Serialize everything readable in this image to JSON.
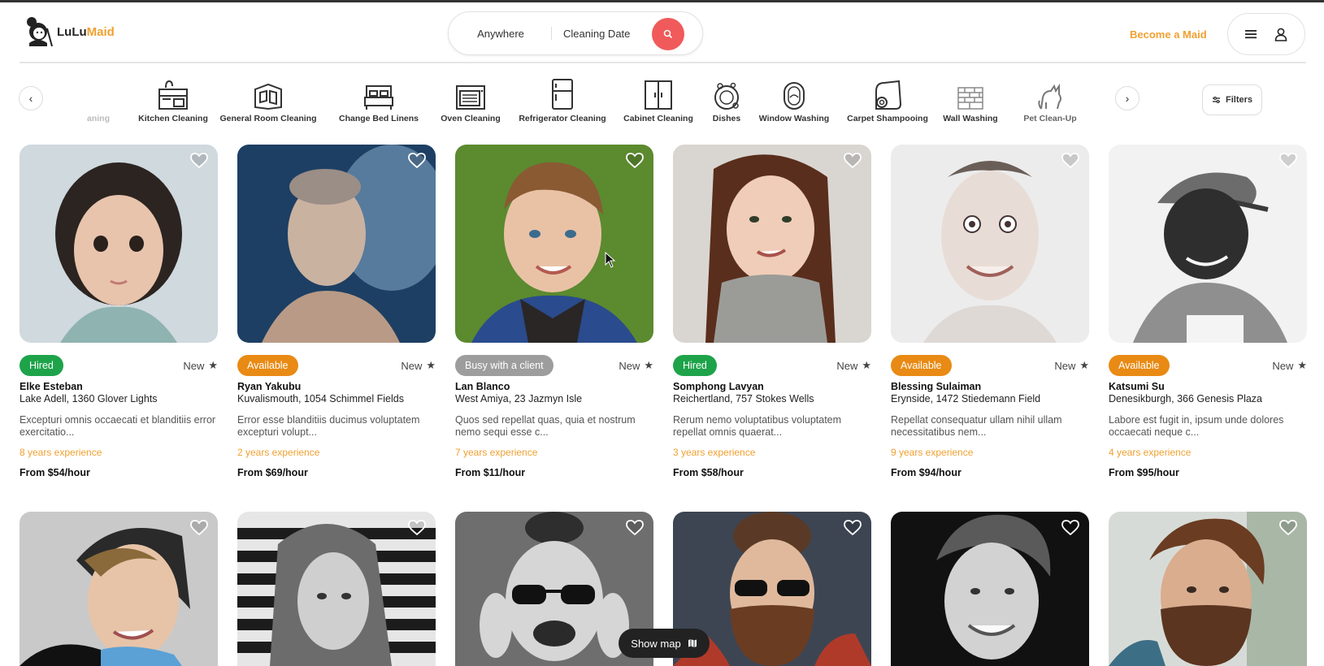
{
  "header": {
    "logo_part1": "LuLu",
    "logo_part2": "Maid",
    "search_location": "Anywhere",
    "search_date": "Cleaning Date",
    "become_maid": "Become a Maid"
  },
  "categories": {
    "items": [
      {
        "label": "Deep Cleaning",
        "visible_label": "aning",
        "icon": "broom-icon"
      },
      {
        "label": "Kitchen Cleaning",
        "icon": "kitchen-icon"
      },
      {
        "label": "General Room Cleaning",
        "icon": "room-icon"
      },
      {
        "label": "Change Bed Linens",
        "icon": "bed-icon"
      },
      {
        "label": "Oven Cleaning",
        "icon": "oven-icon"
      },
      {
        "label": "Refrigerator Cleaning",
        "icon": "refrigerator-icon"
      },
      {
        "label": "Cabinet Cleaning",
        "icon": "cabinet-icon"
      },
      {
        "label": "Dishes",
        "icon": "dishes-icon"
      },
      {
        "label": "Window Washing",
        "icon": "window-icon"
      },
      {
        "label": "Carpet Shampooing",
        "icon": "carpet-icon"
      },
      {
        "label": "Wall Washing",
        "icon": "wall-icon"
      },
      {
        "label": "Pet Clean-Up",
        "icon": "pet-icon"
      }
    ],
    "filters_label": "Filters"
  },
  "listings": [
    {
      "status": "Hired",
      "new": "New",
      "name": "Elke Esteban",
      "address": "Lake Adell, 1360 Glover Lights",
      "description": "Excepturi omnis occaecati et blanditiis error exercitatio...",
      "experience": "8 years experience",
      "price": "From $54/hour"
    },
    {
      "status": "Available",
      "new": "New",
      "name": "Ryan Yakubu",
      "address": "Kuvalismouth, 1054 Schimmel Fields",
      "description": "Error esse blanditiis ducimus voluptatem excepturi volupt...",
      "experience": "2 years experience",
      "price": "From $69/hour"
    },
    {
      "status": "Busy with a client",
      "new": "New",
      "name": "Lan Blanco",
      "address": "West Amiya, 23 Jazmyn Isle",
      "description": "Quos sed repellat quas, quia et nostrum nemo sequi esse c...",
      "experience": "7 years experience",
      "price": "From $11/hour"
    },
    {
      "status": "Hired",
      "new": "New",
      "name": "Somphong Lavyan",
      "address": "Reichertland, 757 Stokes Wells",
      "description": "Rerum nemo voluptatibus voluptatem repellat omnis quaerat...",
      "experience": "3 years experience",
      "price": "From $58/hour"
    },
    {
      "status": "Available",
      "new": "New",
      "name": "Blessing Sulaiman",
      "address": "Erynside, 1472 Stiedemann Field",
      "description": "Repellat consequatur ullam nihil ullam necessitatibus nem...",
      "experience": "9 years experience",
      "price": "From $94/hour"
    },
    {
      "status": "Available",
      "new": "New",
      "name": "Katsumi Su",
      "address": "Denesikburgh, 366 Genesis Plaza",
      "description": "Labore est fugit in, ipsum unde dolores occaecati neque c...",
      "experience": "4 years experience",
      "price": "From $95/hour"
    }
  ],
  "show_map_label": "Show map",
  "colors": {
    "accent": "#f0a030",
    "search_button": "#f05a5a",
    "hired": "#1ea34a",
    "available": "#e88a14",
    "busy": "#9d9d9d"
  }
}
